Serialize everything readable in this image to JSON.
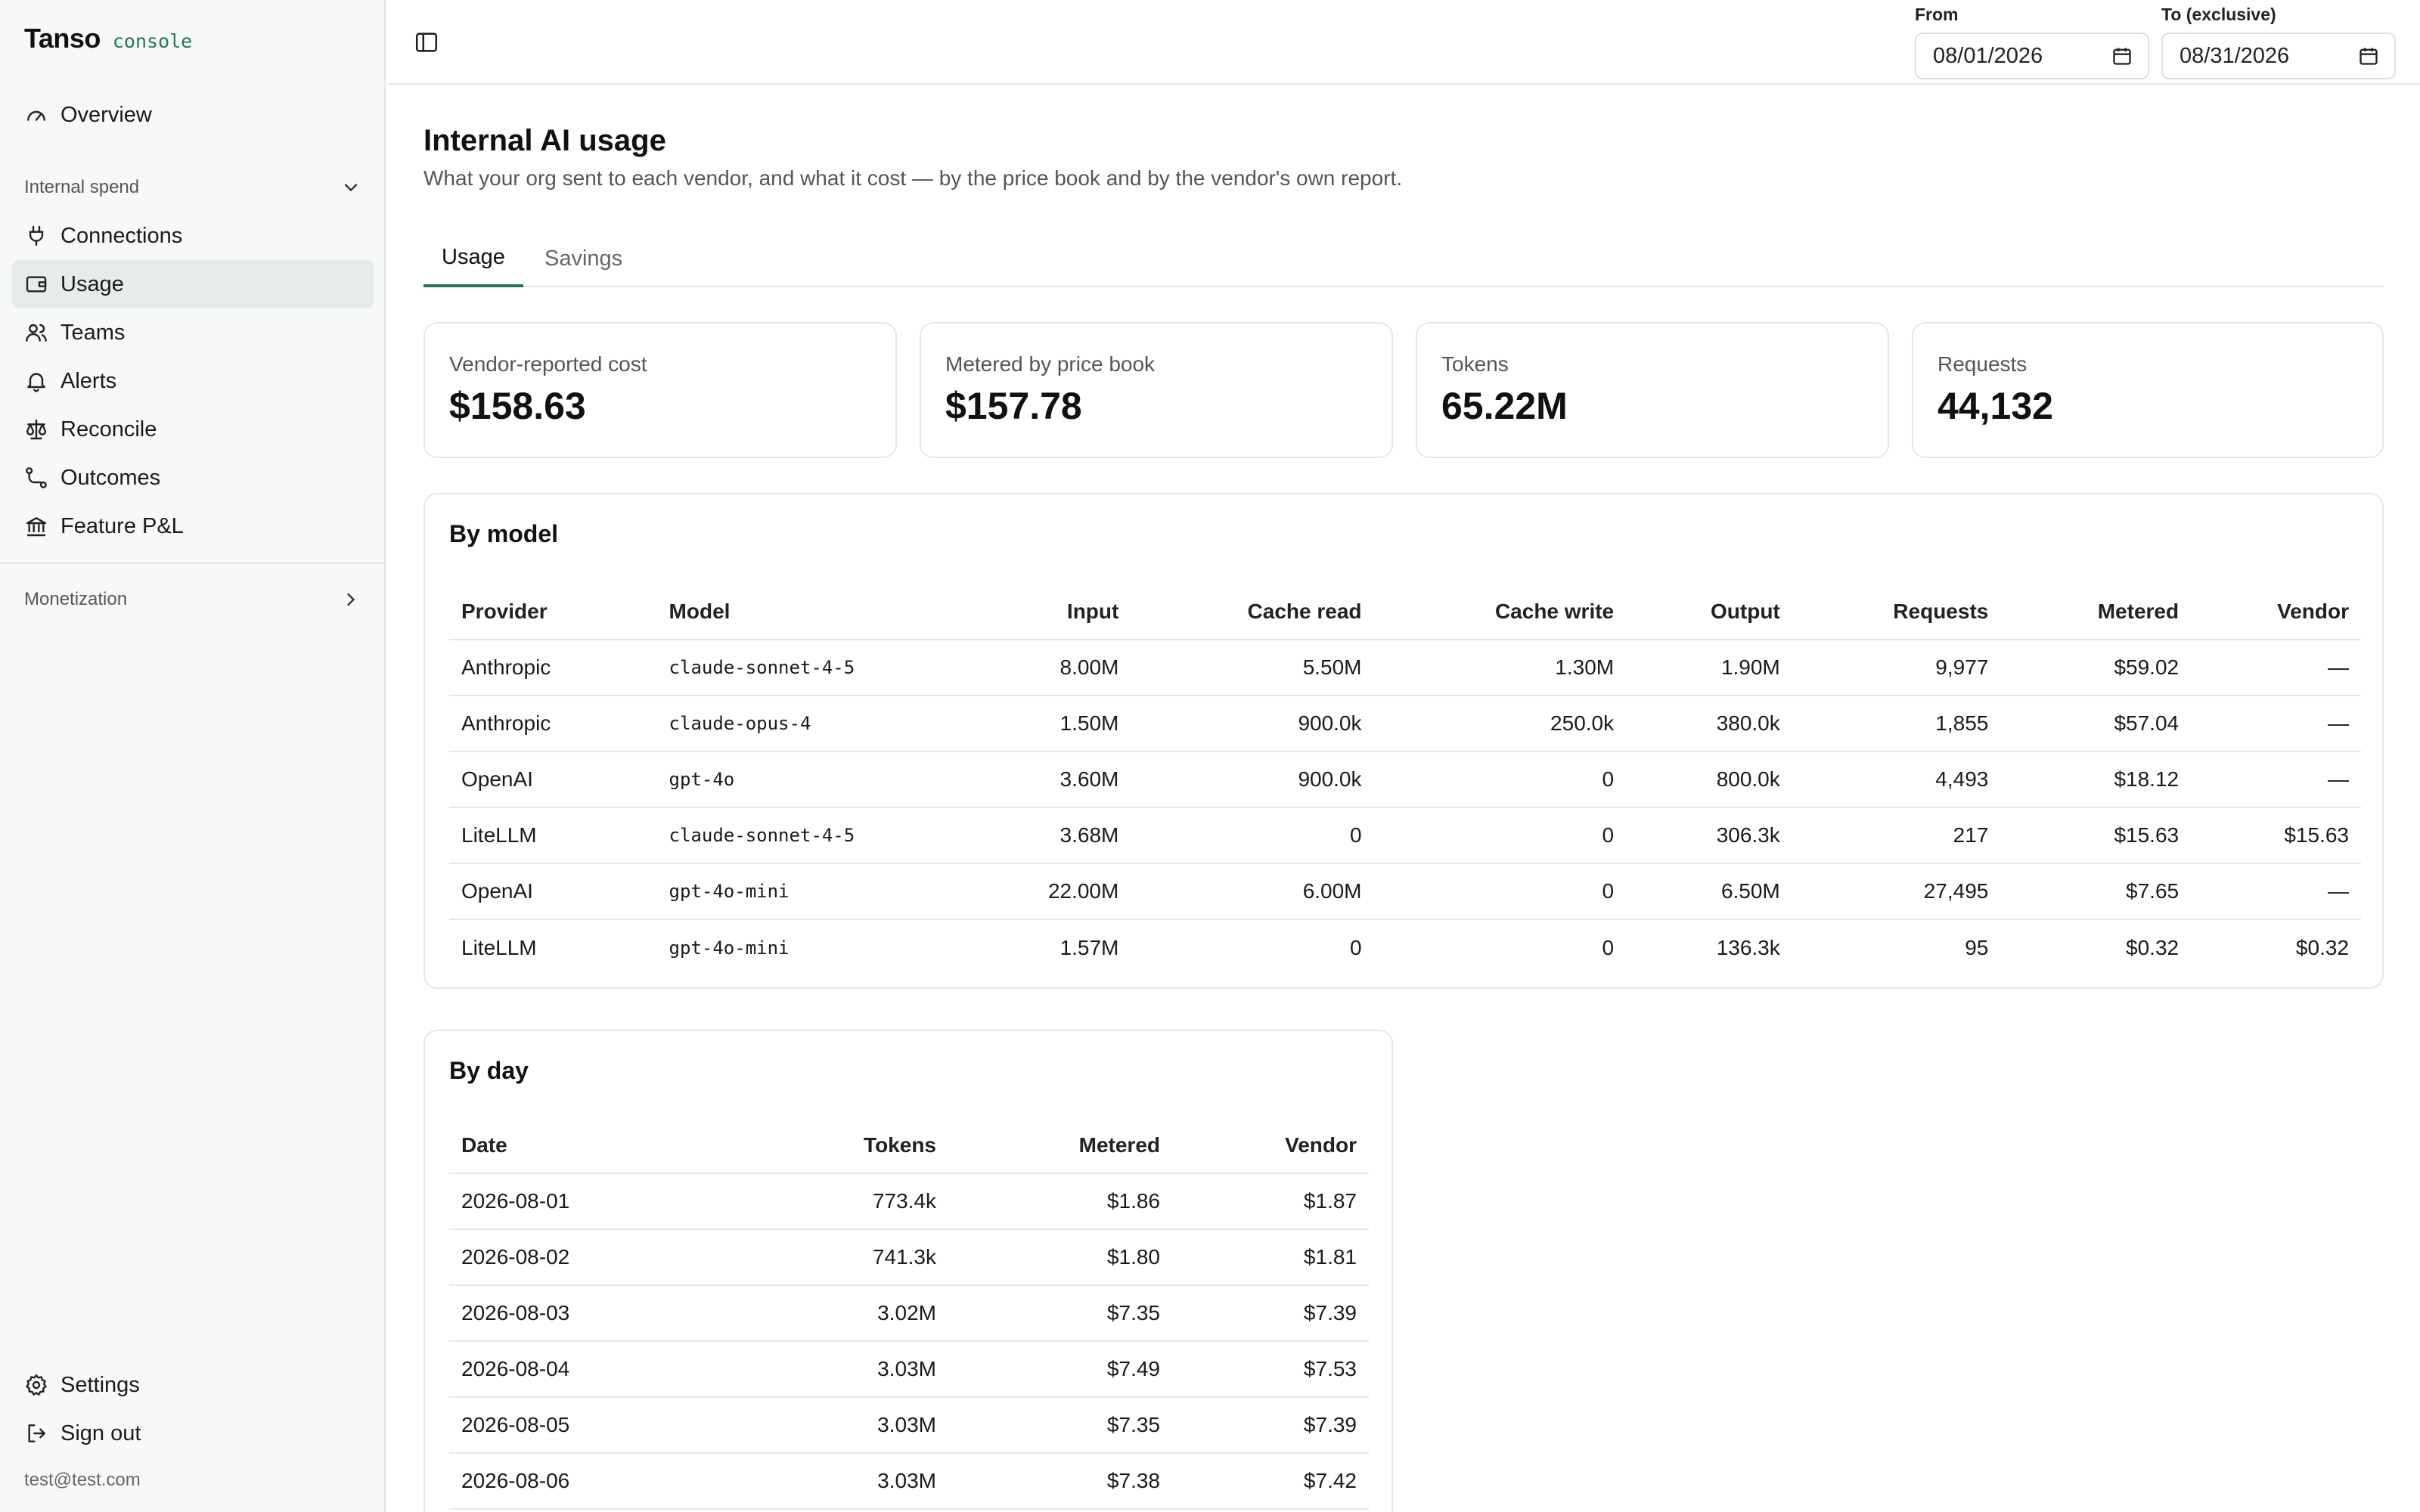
{
  "brand": {
    "name": "Tanso",
    "tag": "console"
  },
  "sidebar": {
    "overview": "Overview",
    "internal_spend": {
      "label": "Internal spend",
      "items": [
        "Connections",
        "Usage",
        "Teams",
        "Alerts",
        "Reconcile",
        "Outcomes",
        "Feature P&L"
      ]
    },
    "monetization": "Monetization",
    "settings": "Settings",
    "sign_out": "Sign out",
    "user_email": "test@test.com"
  },
  "dates": {
    "from_label": "From",
    "from_value": "08/01/2026",
    "to_label": "To (exclusive)",
    "to_value": "08/31/2026"
  },
  "page": {
    "title": "Internal AI usage",
    "subtitle": "What your org sent to each vendor, and what it cost — by the price book and by the vendor's own report."
  },
  "tabs": [
    "Usage",
    "Savings"
  ],
  "kpis": [
    {
      "label": "Vendor-reported cost",
      "value": "$158.63"
    },
    {
      "label": "Metered by price book",
      "value": "$157.78"
    },
    {
      "label": "Tokens",
      "value": "65.22M"
    },
    {
      "label": "Requests",
      "value": "44,132"
    }
  ],
  "by_model": {
    "title": "By model",
    "columns": [
      "Provider",
      "Model",
      "Input",
      "Cache read",
      "Cache write",
      "Output",
      "Requests",
      "Metered",
      "Vendor"
    ],
    "rows": [
      [
        "Anthropic",
        "claude-sonnet-4-5",
        "8.00M",
        "5.50M",
        "1.30M",
        "1.90M",
        "9,977",
        "$59.02",
        "—"
      ],
      [
        "Anthropic",
        "claude-opus-4",
        "1.50M",
        "900.0k",
        "250.0k",
        "380.0k",
        "1,855",
        "$57.04",
        "—"
      ],
      [
        "OpenAI",
        "gpt-4o",
        "3.60M",
        "900.0k",
        "0",
        "800.0k",
        "4,493",
        "$18.12",
        "—"
      ],
      [
        "LiteLLM",
        "claude-sonnet-4-5",
        "3.68M",
        "0",
        "0",
        "306.3k",
        "217",
        "$15.63",
        "$15.63"
      ],
      [
        "OpenAI",
        "gpt-4o-mini",
        "22.00M",
        "6.00M",
        "0",
        "6.50M",
        "27,495",
        "$7.65",
        "—"
      ],
      [
        "LiteLLM",
        "gpt-4o-mini",
        "1.57M",
        "0",
        "0",
        "136.3k",
        "95",
        "$0.32",
        "$0.32"
      ]
    ]
  },
  "by_day": {
    "title": "By day",
    "columns": [
      "Date",
      "Tokens",
      "Metered",
      "Vendor"
    ],
    "rows": [
      [
        "2026-08-01",
        "773.4k",
        "$1.86",
        "$1.87"
      ],
      [
        "2026-08-02",
        "741.3k",
        "$1.80",
        "$1.81"
      ],
      [
        "2026-08-03",
        "3.02M",
        "$7.35",
        "$7.39"
      ],
      [
        "2026-08-04",
        "3.03M",
        "$7.49",
        "$7.53"
      ],
      [
        "2026-08-05",
        "3.03M",
        "$7.35",
        "$7.39"
      ],
      [
        "2026-08-06",
        "3.03M",
        "$7.38",
        "$7.42"
      ]
    ]
  }
}
